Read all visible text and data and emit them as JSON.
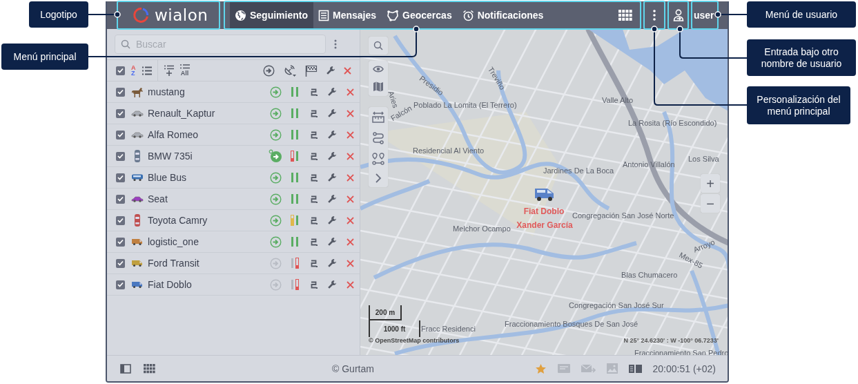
{
  "callouts": [
    {
      "text": "Logotipo"
    },
    {
      "text": "Menú principal"
    },
    {
      "text": "Menú de usuario"
    },
    {
      "text": "Entrada bajo otro nombre de usuario"
    },
    {
      "text": "Personalización del menú principal"
    }
  ],
  "header": {
    "logo": "wialon",
    "nav": [
      {
        "label": "Seguimiento",
        "kind": "globe",
        "selected": true
      },
      {
        "label": "Mensajes",
        "kind": "messages",
        "selected": false
      },
      {
        "label": "Geocercas",
        "kind": "geofence",
        "selected": false
      },
      {
        "label": "Notificaciones",
        "kind": "alarm",
        "selected": false
      }
    ],
    "user": "user"
  },
  "search": {
    "placeholder": "Buscar"
  },
  "list_toolbar": {
    "checked": true,
    "sort_letters": [
      "A",
      "Z"
    ],
    "all_label": "All"
  },
  "units": [
    {
      "name": "mustang",
      "kind": "horse",
      "color": "#7a5a3a",
      "checked": true,
      "online": true,
      "parked": false,
      "indicators": [
        {
          "color": "#5aad63",
          "level": 1
        },
        {
          "color": "#5aad63",
          "level": 1
        }
      ]
    },
    {
      "name": "Renault_Kaptur",
      "kind": "car-side",
      "color": "#a9adb5",
      "checked": true,
      "online": true,
      "parked": false,
      "indicators": [
        {
          "color": "#5aad63",
          "level": 1
        },
        {
          "color": "#5aad63",
          "level": 1
        }
      ]
    },
    {
      "name": "Alfa Romeo",
      "kind": "car-side",
      "color": "#a9adb5",
      "checked": true,
      "online": true,
      "parked": false,
      "indicators": [
        {
          "color": "#5aad63",
          "level": 1
        },
        {
          "color": "#5aad63",
          "level": 1
        }
      ]
    },
    {
      "name": "BMW 735i",
      "kind": "car-top",
      "color": "#6b7a90",
      "checked": true,
      "online": true,
      "parked": true,
      "indicators": [
        {
          "color": "#e05555",
          "level": 0.3
        },
        {
          "color": "#5aad63",
          "level": 1
        }
      ]
    },
    {
      "name": "Blue Bus",
      "kind": "bus",
      "color": "#3a6fb0",
      "checked": true,
      "online": true,
      "parked": false,
      "indicators": [
        {
          "color": "#5aad63",
          "level": 1
        },
        {
          "color": "#5aad63",
          "level": 1
        }
      ]
    },
    {
      "name": "Seat",
      "kind": "car-side",
      "color": "#9b3fc0",
      "checked": true,
      "online": true,
      "parked": false,
      "indicators": [
        {
          "color": "#5aad63",
          "level": 1
        },
        {
          "color": "#5aad63",
          "level": 1
        }
      ]
    },
    {
      "name": "Toyota Camry",
      "kind": "car-top",
      "color": "#c05050",
      "checked": true,
      "online": true,
      "parked": false,
      "indicators": [
        {
          "color": "#e0b84a",
          "level": 0.75
        },
        {
          "color": "#5aad63",
          "level": 1
        }
      ]
    },
    {
      "name": "logistic_one",
      "kind": "van",
      "color": "#c08040",
      "checked": true,
      "online": true,
      "parked": false,
      "indicators": [
        {
          "color": "#5aad63",
          "level": 1
        },
        {
          "color": "#5aad63",
          "level": 1
        }
      ]
    },
    {
      "name": "Ford Transit",
      "kind": "van",
      "color": "#c0a040",
      "checked": true,
      "online": false,
      "parked": false,
      "indicators": [
        {
          "color": "#b3b7bf",
          "level": 1
        },
        {
          "color": "#e05555",
          "level": 0.3
        }
      ]
    },
    {
      "name": "Fiat Doblo",
      "kind": "van",
      "color": "#4a78c0",
      "checked": true,
      "online": false,
      "parked": false,
      "indicators": [
        {
          "color": "#b3b7bf",
          "level": 1
        },
        {
          "color": "#e05555",
          "level": 0.3
        }
      ]
    }
  ],
  "map": {
    "labels": [
      "Presidio",
      "Treviño",
      "Aries",
      "Falcón",
      "Poblado La Lomita (El Terrero)",
      "Valle Alto",
      "La Rosita (Río Escondido)",
      "Residencial Al Viento",
      "Jardines De La Boca",
      "Antonio Villalón",
      "Los Silva",
      "Melchor Ocampo",
      "Congregación San José Norte",
      "Mex-85",
      "Arroyo",
      "Blas Chumacero",
      "Congregación San José Sur",
      "Fraccionamiento Bosques De San José",
      "Fracc Residenci",
      "Fraccionamiento San Pedro"
    ],
    "unit_label": "Fiat Doblo",
    "driver_label": "Xander García",
    "zoom_in": "+",
    "zoom_out": "−",
    "scale": [
      "200 m",
      "1000 ft"
    ],
    "attribution": "© OpenStreetMap contributors",
    "coordinates": "N 25° 24.6230' : W -100° 06.7233'"
  },
  "footer": {
    "copyright": "© Gurtam",
    "time": "20:00:51 (+02)"
  }
}
